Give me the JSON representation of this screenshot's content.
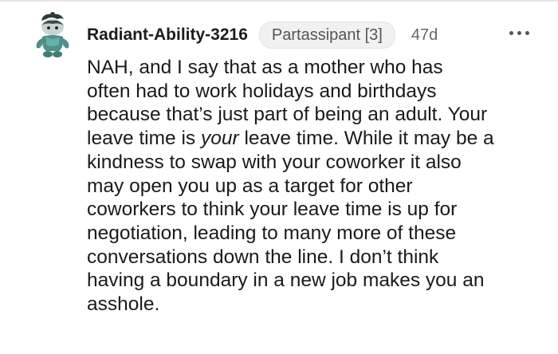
{
  "comment": {
    "author": "Radiant-Ability-3216",
    "flair": "Partassipant [3]",
    "age": "47d",
    "avatar_icon": "snoo-avatar-icon",
    "more_icon": "more-options-icon",
    "body_lines": [
      {
        "text": "NAH, and I say that as a mother who has"
      },
      {
        "text": "often had to work holidays and birthdays"
      },
      {
        "text": "because that’s just part of being an adult. Your"
      },
      {
        "before": "leave time is ",
        "em": "your",
        "after": " leave time. While it may be a"
      },
      {
        "text": "kindness to swap with your coworker it also"
      },
      {
        "text": "may open you up as a target for other"
      },
      {
        "text": "coworkers to think your leave time is up for"
      },
      {
        "text": "negotiation, leading to many more of these"
      },
      {
        "text": "conversations down the line. I don’t think"
      },
      {
        "text": "having a boundary in a new job makes you an"
      },
      {
        "text": "asshole."
      }
    ]
  }
}
